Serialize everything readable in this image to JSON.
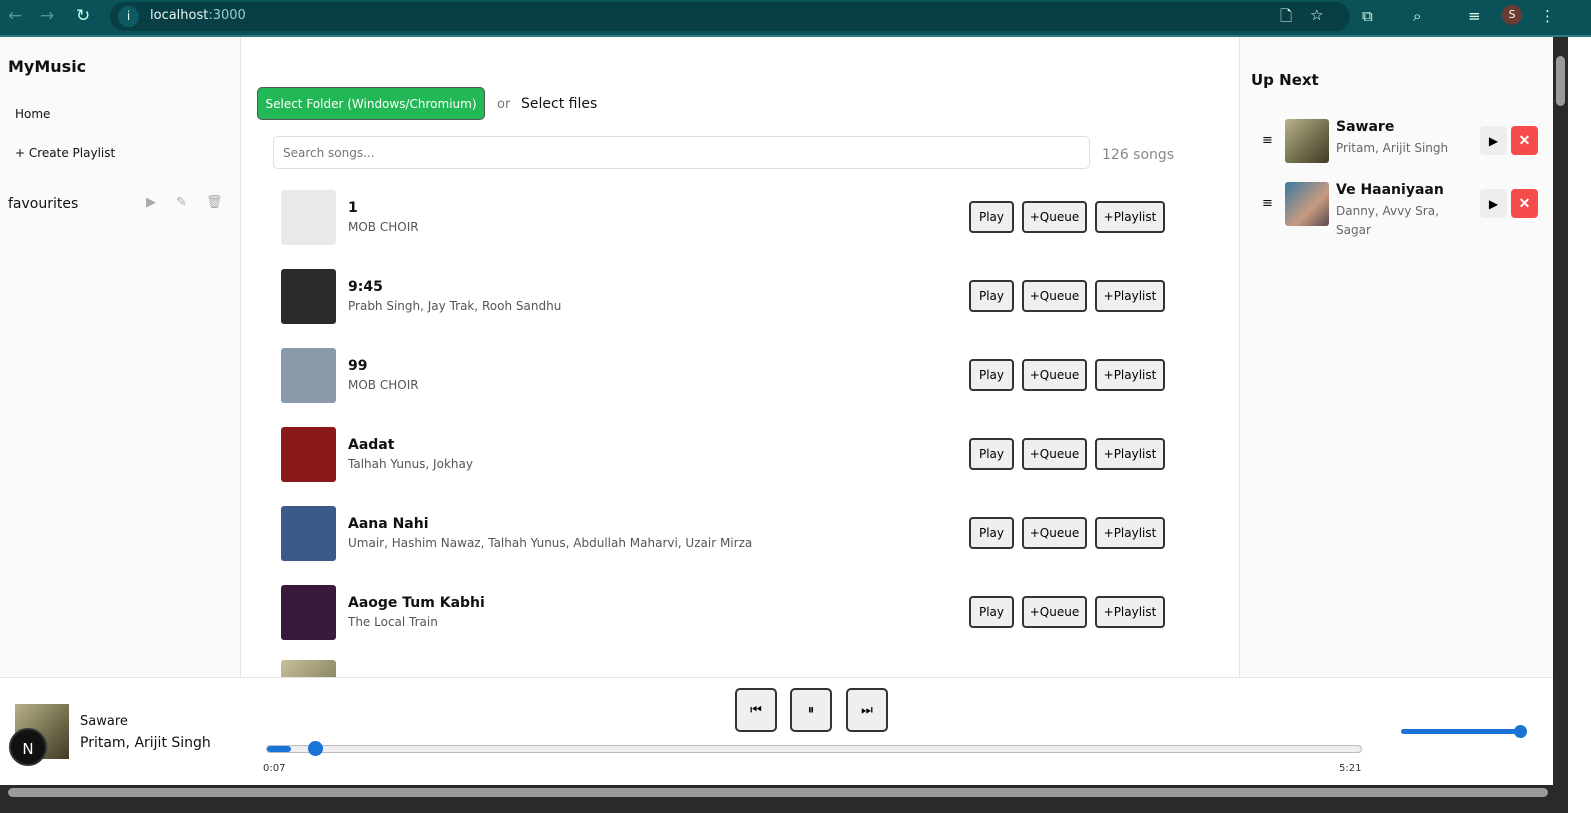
{
  "browser": {
    "url_host": "localhost",
    "url_port": ":3000",
    "avatar_letter": "S"
  },
  "sidebar": {
    "brand": "MyMusic",
    "home": "Home",
    "create_playlist": "+ Create Playlist",
    "playlists": [
      {
        "name": "favourites"
      }
    ]
  },
  "main": {
    "select_folder": "Select Folder (Windows/Chromium)",
    "or": "or",
    "select_files": "Select files",
    "search_placeholder": "Search songs...",
    "count": "126 songs",
    "row_buttons": {
      "play": "Play",
      "queue": "+Queue",
      "playlist": "+Playlist"
    },
    "songs": [
      {
        "title": "1",
        "artist": "MOB CHOIR",
        "color": "#e9e9e9"
      },
      {
        "title": "9:45",
        "artist": "Prabh Singh, Jay Trak, Rooh Sandhu",
        "color": "#2a2a2a"
      },
      {
        "title": "99",
        "artist": "MOB CHOIR",
        "color": "#8a9aa8"
      },
      {
        "title": "Aadat",
        "artist": "Talhah Yunus, Jokhay",
        "color": "#8a1a1a"
      },
      {
        "title": "Aana Nahi",
        "artist": "Umair, Hashim Nawaz, Talhah Yunus, Abdullah Maharvi, Uzair Mirza",
        "color": "#3a5a8a"
      },
      {
        "title": "Aaoge Tum Kabhi",
        "artist": "The Local Train",
        "color": "#3a1a3a"
      }
    ]
  },
  "up_next": {
    "title": "Up Next",
    "items": [
      {
        "title": "Saware",
        "artist": "Pritam, Arijit Singh"
      },
      {
        "title": "Ve Haaniyaan",
        "artist": "Danny, Avvy Sra, Sagar"
      }
    ]
  },
  "player": {
    "title": "Saware",
    "artist": "Pritam, Arijit Singh",
    "current": "0:07",
    "duration": "5:21",
    "progress_fraction": 0.022,
    "volume_fraction": 1.0,
    "badge": "N"
  }
}
